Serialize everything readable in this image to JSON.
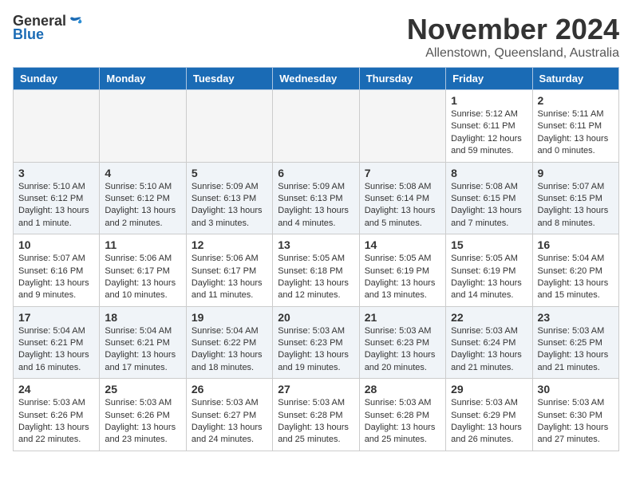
{
  "logo": {
    "general": "General",
    "blue": "Blue"
  },
  "title": "November 2024",
  "location": "Allenstown, Queensland, Australia",
  "weekdays": [
    "Sunday",
    "Monday",
    "Tuesday",
    "Wednesday",
    "Thursday",
    "Friday",
    "Saturday"
  ],
  "weeks": [
    [
      {
        "day": "",
        "info": ""
      },
      {
        "day": "",
        "info": ""
      },
      {
        "day": "",
        "info": ""
      },
      {
        "day": "",
        "info": ""
      },
      {
        "day": "",
        "info": ""
      },
      {
        "day": "1",
        "info": "Sunrise: 5:12 AM\nSunset: 6:11 PM\nDaylight: 12 hours\nand 59 minutes."
      },
      {
        "day": "2",
        "info": "Sunrise: 5:11 AM\nSunset: 6:11 PM\nDaylight: 13 hours\nand 0 minutes."
      }
    ],
    [
      {
        "day": "3",
        "info": "Sunrise: 5:10 AM\nSunset: 6:12 PM\nDaylight: 13 hours\nand 1 minute."
      },
      {
        "day": "4",
        "info": "Sunrise: 5:10 AM\nSunset: 6:12 PM\nDaylight: 13 hours\nand 2 minutes."
      },
      {
        "day": "5",
        "info": "Sunrise: 5:09 AM\nSunset: 6:13 PM\nDaylight: 13 hours\nand 3 minutes."
      },
      {
        "day": "6",
        "info": "Sunrise: 5:09 AM\nSunset: 6:13 PM\nDaylight: 13 hours\nand 4 minutes."
      },
      {
        "day": "7",
        "info": "Sunrise: 5:08 AM\nSunset: 6:14 PM\nDaylight: 13 hours\nand 5 minutes."
      },
      {
        "day": "8",
        "info": "Sunrise: 5:08 AM\nSunset: 6:15 PM\nDaylight: 13 hours\nand 7 minutes."
      },
      {
        "day": "9",
        "info": "Sunrise: 5:07 AM\nSunset: 6:15 PM\nDaylight: 13 hours\nand 8 minutes."
      }
    ],
    [
      {
        "day": "10",
        "info": "Sunrise: 5:07 AM\nSunset: 6:16 PM\nDaylight: 13 hours\nand 9 minutes."
      },
      {
        "day": "11",
        "info": "Sunrise: 5:06 AM\nSunset: 6:17 PM\nDaylight: 13 hours\nand 10 minutes."
      },
      {
        "day": "12",
        "info": "Sunrise: 5:06 AM\nSunset: 6:17 PM\nDaylight: 13 hours\nand 11 minutes."
      },
      {
        "day": "13",
        "info": "Sunrise: 5:05 AM\nSunset: 6:18 PM\nDaylight: 13 hours\nand 12 minutes."
      },
      {
        "day": "14",
        "info": "Sunrise: 5:05 AM\nSunset: 6:19 PM\nDaylight: 13 hours\nand 13 minutes."
      },
      {
        "day": "15",
        "info": "Sunrise: 5:05 AM\nSunset: 6:19 PM\nDaylight: 13 hours\nand 14 minutes."
      },
      {
        "day": "16",
        "info": "Sunrise: 5:04 AM\nSunset: 6:20 PM\nDaylight: 13 hours\nand 15 minutes."
      }
    ],
    [
      {
        "day": "17",
        "info": "Sunrise: 5:04 AM\nSunset: 6:21 PM\nDaylight: 13 hours\nand 16 minutes."
      },
      {
        "day": "18",
        "info": "Sunrise: 5:04 AM\nSunset: 6:21 PM\nDaylight: 13 hours\nand 17 minutes."
      },
      {
        "day": "19",
        "info": "Sunrise: 5:04 AM\nSunset: 6:22 PM\nDaylight: 13 hours\nand 18 minutes."
      },
      {
        "day": "20",
        "info": "Sunrise: 5:03 AM\nSunset: 6:23 PM\nDaylight: 13 hours\nand 19 minutes."
      },
      {
        "day": "21",
        "info": "Sunrise: 5:03 AM\nSunset: 6:23 PM\nDaylight: 13 hours\nand 20 minutes."
      },
      {
        "day": "22",
        "info": "Sunrise: 5:03 AM\nSunset: 6:24 PM\nDaylight: 13 hours\nand 21 minutes."
      },
      {
        "day": "23",
        "info": "Sunrise: 5:03 AM\nSunset: 6:25 PM\nDaylight: 13 hours\nand 21 minutes."
      }
    ],
    [
      {
        "day": "24",
        "info": "Sunrise: 5:03 AM\nSunset: 6:26 PM\nDaylight: 13 hours\nand 22 minutes."
      },
      {
        "day": "25",
        "info": "Sunrise: 5:03 AM\nSunset: 6:26 PM\nDaylight: 13 hours\nand 23 minutes."
      },
      {
        "day": "26",
        "info": "Sunrise: 5:03 AM\nSunset: 6:27 PM\nDaylight: 13 hours\nand 24 minutes."
      },
      {
        "day": "27",
        "info": "Sunrise: 5:03 AM\nSunset: 6:28 PM\nDaylight: 13 hours\nand 25 minutes."
      },
      {
        "day": "28",
        "info": "Sunrise: 5:03 AM\nSunset: 6:28 PM\nDaylight: 13 hours\nand 25 minutes."
      },
      {
        "day": "29",
        "info": "Sunrise: 5:03 AM\nSunset: 6:29 PM\nDaylight: 13 hours\nand 26 minutes."
      },
      {
        "day": "30",
        "info": "Sunrise: 5:03 AM\nSunset: 6:30 PM\nDaylight: 13 hours\nand 27 minutes."
      }
    ]
  ]
}
